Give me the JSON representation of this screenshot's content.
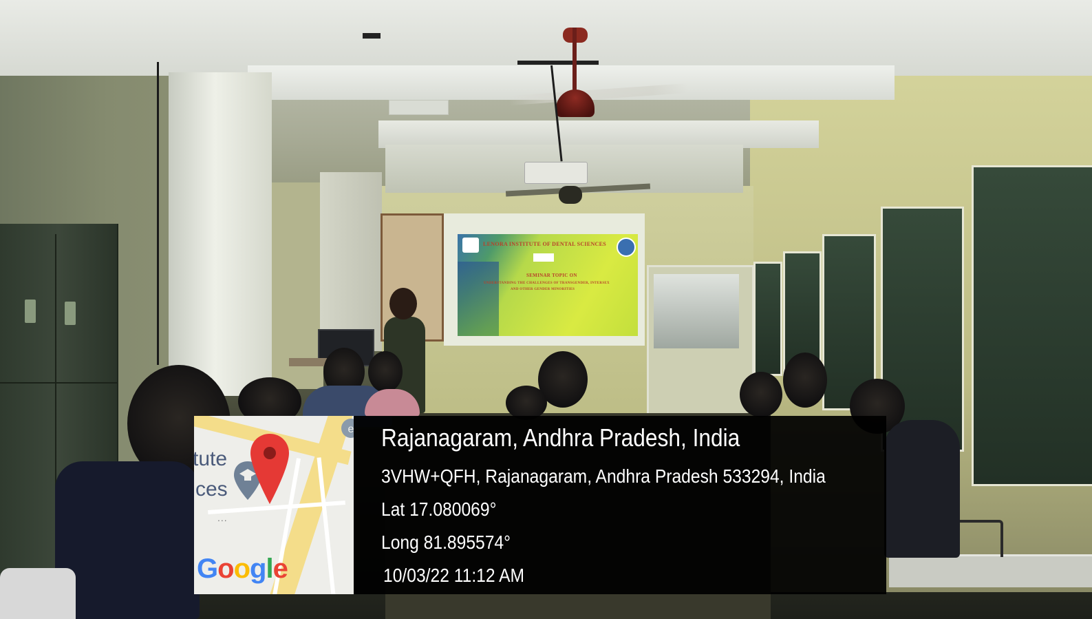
{
  "slide": {
    "institute": "LENORA INSTITUTE OF DENTAL SCIENCES",
    "topic_heading": "SEMINAR TOPIC ON",
    "topic_line1": "UNDERSTANDING THE CHALLENGES OF TRANSGENDER, INTERSEX",
    "topic_line2": "AND OTHER GENDER MINORITIES"
  },
  "geotag": {
    "location_title": "Rajanagaram, Andhra Pradesh, India",
    "address": "3VHW+QFH, Rajanagaram, Andhra Pradesh 533294, India",
    "latitude": "Lat 17.080069°",
    "longitude": "Long 81.895574°",
    "datetime": "10/03/22 11:12 AM"
  },
  "map": {
    "label_partial_1": "tute",
    "label_partial_2": "ces",
    "ellipsis": "...",
    "brand": "Google",
    "pin_color": "#e53935",
    "poi_icon": "graduation-cap-icon"
  },
  "colors": {
    "slide_green": "#c3df3c",
    "overlay": "#000000",
    "google_blue": "#4285f4",
    "google_red": "#ea4335",
    "google_yellow": "#fbbc05",
    "google_green": "#34a853"
  }
}
